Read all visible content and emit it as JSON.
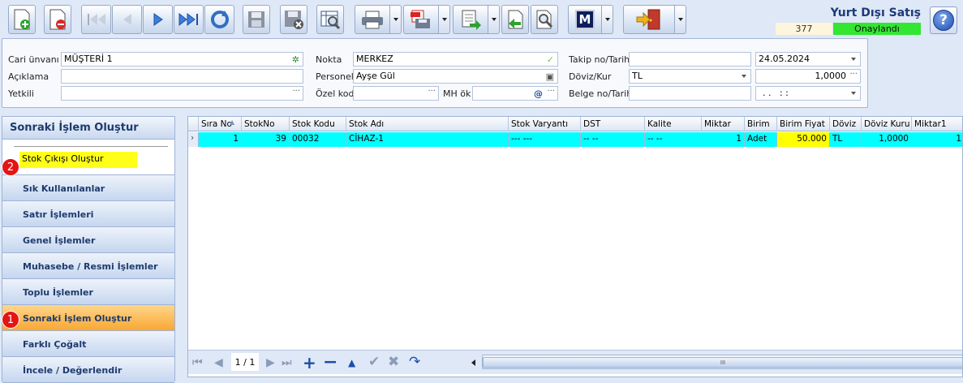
{
  "header": {
    "title": "Yurt Dışı Satış",
    "doc_no": "377",
    "status": "Onaylandı",
    "help_icon": "help-icon"
  },
  "toolbar": {
    "icons": [
      "new-icon",
      "delete-icon",
      "first-icon",
      "prev-icon",
      "next-icon",
      "last-icon",
      "refresh-icon",
      "save-icon",
      "save-close-icon",
      "preview-icon",
      "print-icon",
      "pdf-icon",
      "export-icon",
      "back-icon",
      "search-icon",
      "m-icon",
      "exit-icon"
    ]
  },
  "form": {
    "cari_unvani_label": "Cari ünvanı",
    "cari_unvani": "MÜŞTERİ 1",
    "aciklama_label": "Açıklama",
    "aciklama": "",
    "yetkili_label": "Yetkili",
    "yetkili": "",
    "nokta_label": "Nokta",
    "nokta": "MERKEZ",
    "personel_label": "Personel",
    "personel": "Ayşe Gül",
    "ozel_kod_label": "Özel kod",
    "ozel_kod": "",
    "mh_ok_label": "MH ök",
    "mh_ok": "",
    "takip_label": "Takip no/Tarih",
    "takip_no": "",
    "tarih": "24.05.2024",
    "doviz_label": "Döviz/Kur",
    "doviz": "TL",
    "kur": "1,0000",
    "belge_label": "Belge no/Tarih",
    "belge_no": "",
    "belge_tarih": ". .   : :"
  },
  "left_panel": {
    "title": "Sonraki İşlem Oluştur",
    "active_item": "Stok Çıkışı Oluştur",
    "badge_1": "1",
    "badge_2": "2",
    "nav": [
      "Sık Kullanılanlar",
      "Satır İşlemleri",
      "Genel İşlemler",
      "Muhasebe / Resmi İşlemler",
      "Toplu İşlemler",
      "Sonraki İşlem Oluştur",
      "Farklı Çoğalt",
      "İncele / Değerlendir"
    ]
  },
  "grid": {
    "columns": [
      "Sıra No",
      "StokNo",
      "Stok Kodu",
      "Stok Adı",
      "Stok Varyantı",
      "DST",
      "Kalite",
      "Miktar",
      "Birim",
      "Birim Fiyat",
      "Döviz",
      "Döviz Kuru",
      "Miktar1"
    ],
    "rows": [
      [
        "1",
        "39",
        "00032",
        "CİHAZ-1",
        "--- ---",
        "-- --",
        "-- --",
        "1",
        "Adet",
        "50.000",
        "TL",
        "1,0000",
        "1"
      ]
    ],
    "pager": "1 / 1",
    "thumb_text": "III"
  },
  "colors": {
    "selected_row": "#00ffff",
    "highlight": "#ffff00",
    "status_green": "#32e632",
    "badge_red": "#e51414",
    "active_nav": "#f9a733"
  }
}
